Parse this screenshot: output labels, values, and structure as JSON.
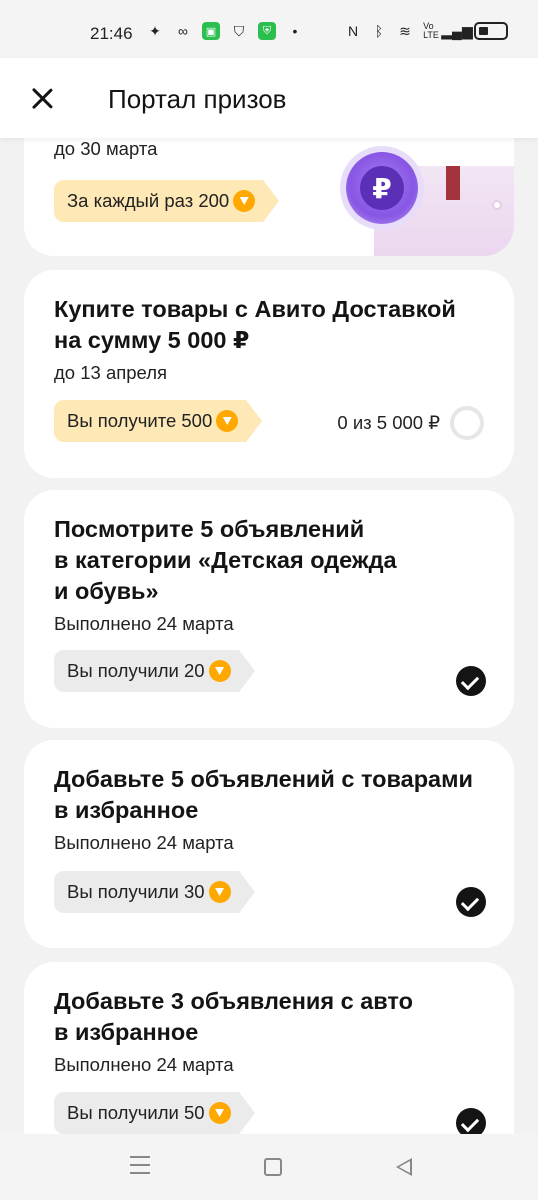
{
  "status_bar": {
    "time": "21:46"
  },
  "header": {
    "title": "Портал призов"
  },
  "colors": {
    "tag_yellow": "#fde8b6",
    "tag_grey": "#ebebeb",
    "coin": "#ffa800",
    "check": "#141414"
  },
  "tasks": [
    {
      "deadline": "до 30 марта",
      "reward": "За каждый раз 200",
      "status": "active"
    },
    {
      "title_line1": "Купите товары с Авито Доставкой",
      "title_line2": "на сумму 5 000 ₽",
      "deadline": "до 13 апреля",
      "reward": "Вы получите 500",
      "progress": "0 из 5 000 ₽",
      "status": "active"
    },
    {
      "title_line1": "Посмотрите 5 объявлений",
      "title_line2": "в категории «Детская одежда",
      "title_line3": "и обувь»",
      "deadline": "Выполнено 24 марта",
      "reward": "Вы получили 20",
      "status": "done"
    },
    {
      "title_line1": "Добавьте 5 объявлений с товарами",
      "title_line2": "в избранное",
      "deadline": "Выполнено 24 марта",
      "reward": "Вы получили 30",
      "status": "done"
    },
    {
      "title_line1": "Добавьте 3 объявления с авто",
      "title_line2": "в избранное",
      "deadline": "Выполнено 24 марта",
      "reward": "Вы получили 50",
      "status": "done"
    }
  ]
}
